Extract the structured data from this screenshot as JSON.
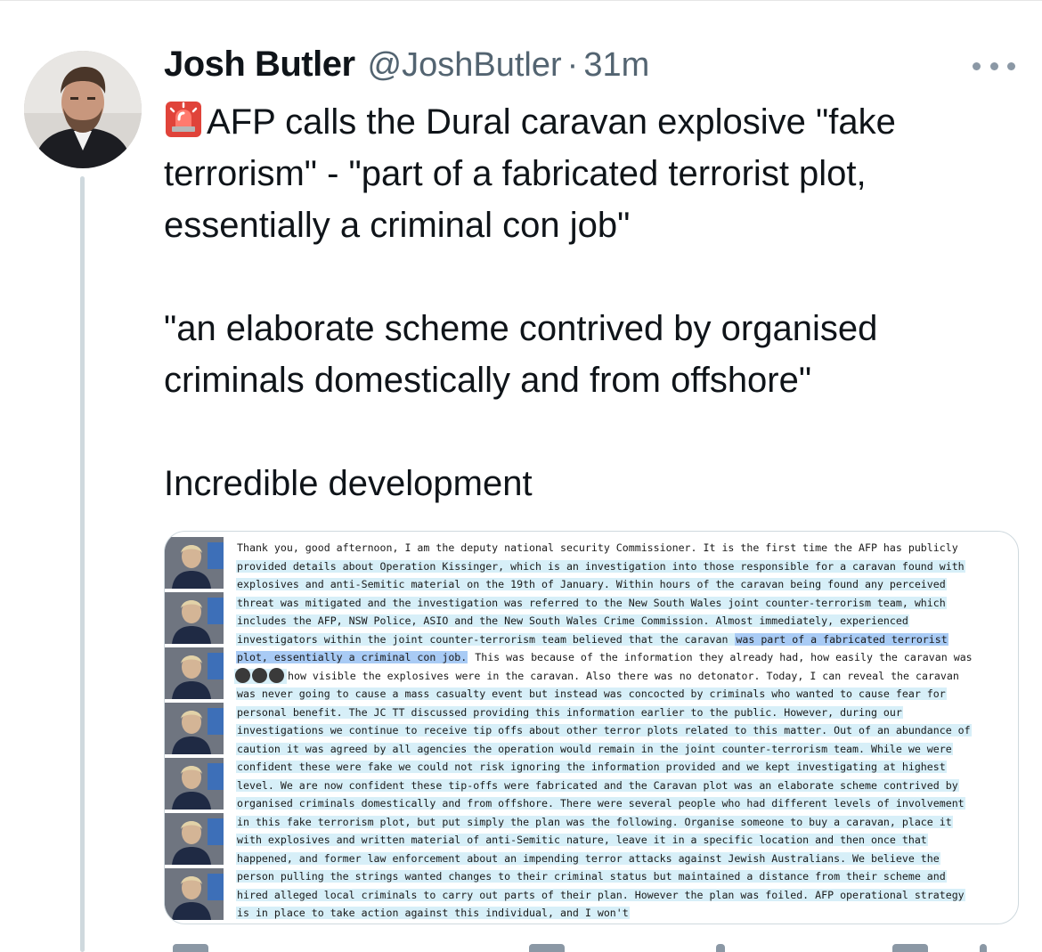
{
  "tweet": {
    "author_name": "Josh Butler",
    "handle": "@JoshButler",
    "separator": "·",
    "time": "31m",
    "text_lines_1": [
      "AFP calls the Dural caravan explosive \"fake",
      "terrorism\" - \"part of a fabricated terrorist plot,",
      "essentially a criminal con job\""
    ],
    "text_lines_2": [
      "\"an elaborate scheme contrived by organised",
      "criminals domestically and from offshore\""
    ],
    "text_line_3": "Incredible development",
    "siren_icon": "police-car-light-icon"
  },
  "media": {
    "transcript_lines": [
      "Thank you, good afternoon, I am the deputy national security Commissioner. It is the first time the AFP has publicly",
      "provided details about Operation Kissinger, which is an investigation into those responsible for a caravan found with",
      "explosives and anti-Semitic material on the 19th of January. Within hours of the caravan being found any perceived",
      "threat was mitigated and the investigation was referred to the New South Wales joint counter-terrorism team, which",
      "includes the AFP, NSW Police, ASIO and the New South Wales Crime Commission. Almost immediately, experienced",
      "investigators within the joint counter-terrorism team believed that the caravan ",
      "was part of a fabricated terrorist",
      "plot, essentially a criminal con job.",
      " This was because of the information they already had, how easily the caravan was",
      "how visible the explosives were in the caravan. Also there was no detonator. Today, I can reveal the caravan",
      "was never going to cause a mass casualty event but instead was concocted by criminals who wanted to cause fear for",
      "personal benefit. The JC TT discussed providing this information earlier to the public. However, during our",
      "investigations we continue to receive tip offs about other terror plots related to this matter. Out of an abundance of",
      "caution it was agreed by all agencies the operation would remain in the joint counter-terrorism team. While we were",
      "confident these were fake we could not risk ignoring the information provided and we kept investigating at highest",
      "level. We are now confident these tip-offs were fabricated and the Caravan plot was an elaborate scheme contrived by",
      "organised criminals domestically and from offshore. There were several people who had different levels of involvement",
      "in this fake terrorism plot, but put simply the plan was the following. Organise someone to buy a caravan, place it",
      "with explosives and written material of anti-Semitic nature, leave it in a specific location and then once that",
      "happened, and former law enforcement about an impending terror attacks against Jewish Australians. We believe the",
      "person pulling the strings wanted changes to their criminal status but maintained a distance from their scheme and",
      "hired alleged local criminals to carry out parts of their plan. However the plan was foiled. AFP operational strategy",
      "is in place to take action against this individual, and I won't"
    ],
    "overlay_icons": [
      "link-icon",
      "quote-icon",
      "bird-icon"
    ]
  }
}
